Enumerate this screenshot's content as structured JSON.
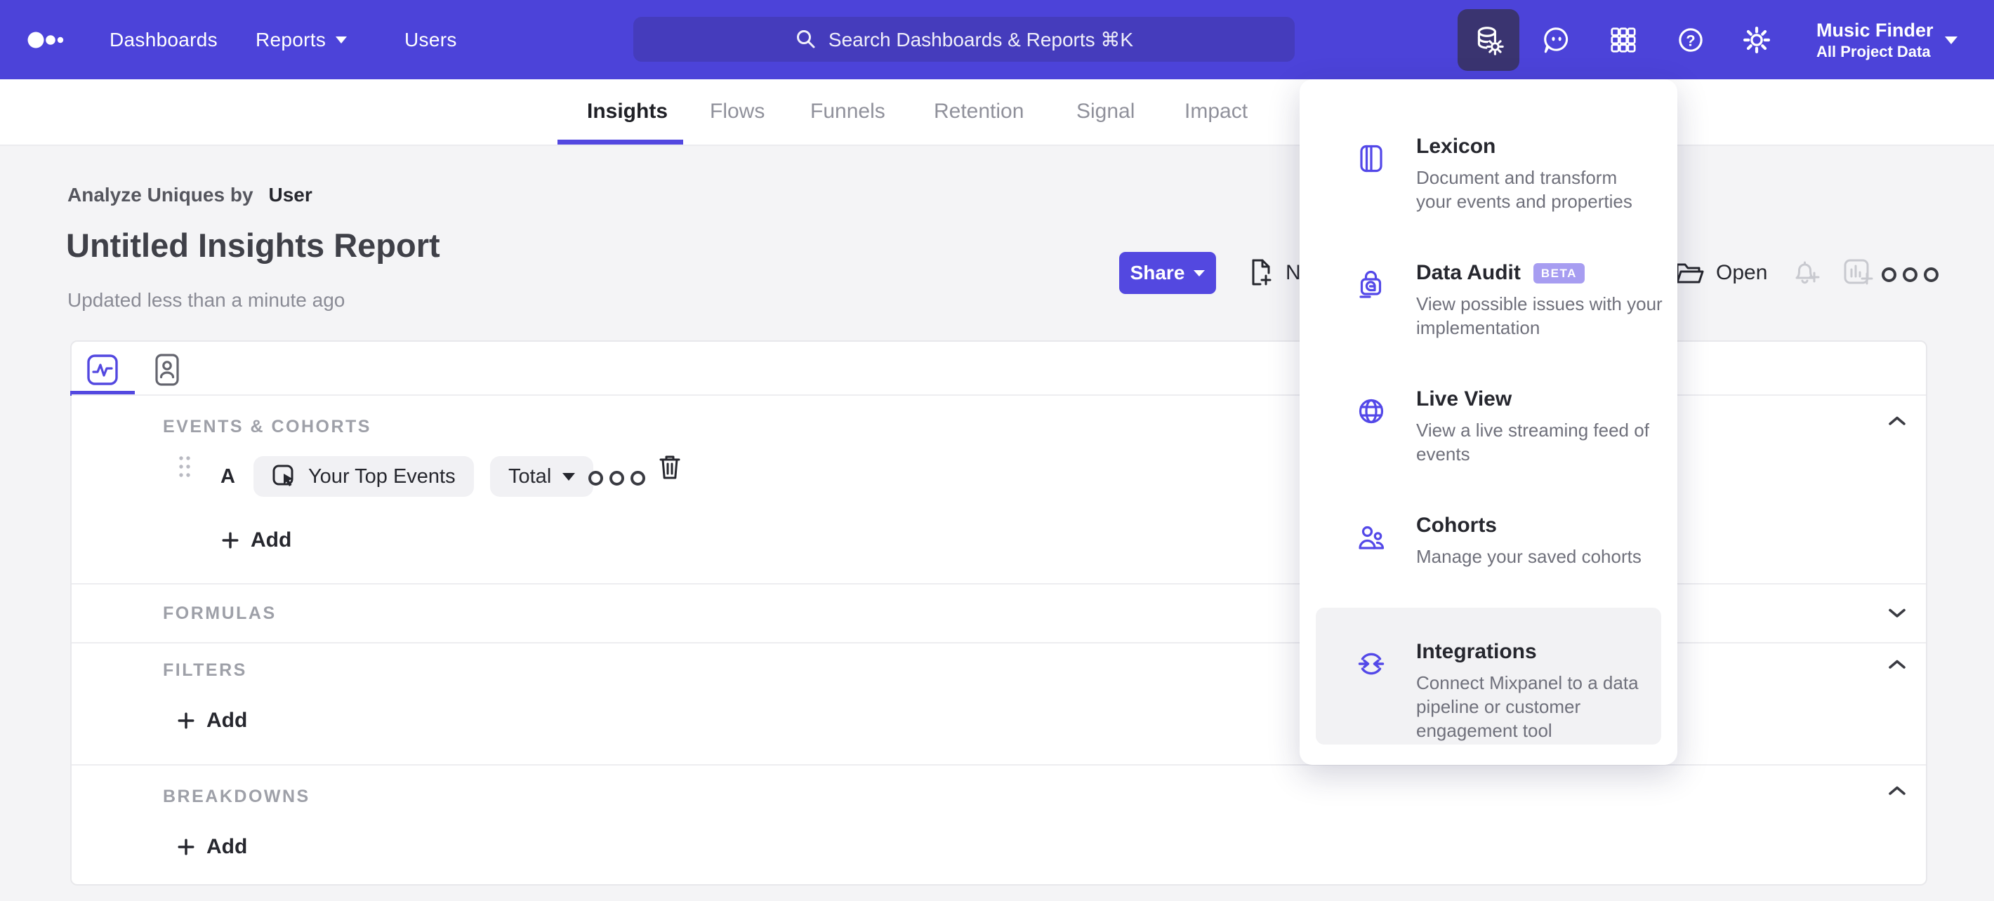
{
  "colors": {
    "nav": "#4C43D9",
    "nav_active_btn": "#3A3470",
    "accent": "#5348E0",
    "page_bg": "#F4F4F6",
    "chip_bg": "#F1F1F4",
    "text_dark": "#26272E",
    "text_gray": "#6F707B",
    "label_gray": "#9EA0A8",
    "disabled_icon": "#C8C9CF",
    "badge_bg": "#A79DF1",
    "highlight_bg": "#F2F2F4"
  },
  "nav": {
    "links": [
      "Dashboards",
      "Reports",
      "Users"
    ],
    "search_placeholder": "Search Dashboards & Reports ⌘K",
    "project_name": "Music Finder",
    "project_scope": "All Project Data"
  },
  "tabs": {
    "active": "Insights",
    "items": [
      "Insights",
      "Flows",
      "Funnels",
      "Retention",
      "Signal",
      "Impact"
    ]
  },
  "report": {
    "analyze_label": "Analyze Uniques by",
    "analyze_value": "User",
    "title": "Untitled Insights Report",
    "updated": "Updated less than a minute ago",
    "share": "Share",
    "new_partial": "N",
    "open": "Open"
  },
  "builder": {
    "events_section": {
      "label": "EVENTS & COHORTS",
      "row": {
        "letter": "A",
        "event": "Your Top Events",
        "metric": "Total"
      },
      "add": "Add"
    },
    "formulas_section": {
      "label": "FORMULAS"
    },
    "filters_section": {
      "label": "FILTERS",
      "add": "Add"
    },
    "breakdowns_section": {
      "label": "BREAKDOWNS",
      "add": "Add"
    }
  },
  "menu": {
    "items": [
      {
        "icon": "book-icon",
        "title": "Lexicon",
        "desc_lines": [
          "Document and transform",
          "your events and properties"
        ]
      },
      {
        "icon": "audit-lock-icon",
        "title": "Data Audit",
        "badge": "BETA",
        "desc_lines": [
          "View possible issues with your",
          "implementation"
        ]
      },
      {
        "icon": "globe-icon",
        "title": "Live View",
        "desc_lines": [
          "View a live streaming feed of",
          "events"
        ]
      },
      {
        "icon": "cohorts-people-icon",
        "title": "Cohorts",
        "desc_lines": [
          "Manage your saved cohorts"
        ]
      },
      {
        "icon": "integrations-sync-icon",
        "title": "Integrations",
        "highlighted": true,
        "desc_lines": [
          "Connect Mixpanel to a data",
          "pipeline or customer",
          "engagement tool"
        ]
      }
    ]
  }
}
